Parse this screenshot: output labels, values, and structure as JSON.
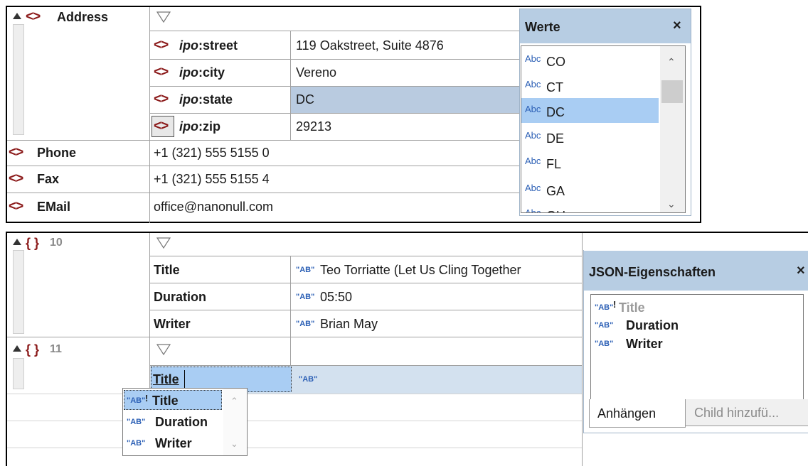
{
  "xml_grid": {
    "address": {
      "icon": "element-icon",
      "label": "Address"
    },
    "rows": [
      {
        "prefix": "ipo",
        "name": "street",
        "value": "119 Oakstreet, Suite 4876"
      },
      {
        "prefix": "ipo",
        "name": "city",
        "value": "Vereno"
      },
      {
        "prefix": "ipo",
        "name": "state",
        "value": "DC"
      },
      {
        "prefix": "ipo",
        "name": "zip",
        "value": "29213"
      }
    ],
    "top_rows": [
      {
        "label": "Phone",
        "value": "+1 (321) 555 5155 0"
      },
      {
        "label": "Fax",
        "value": "+1 (321) 555 5155 4"
      },
      {
        "label": "EMail",
        "value": "office@nanonull.com"
      }
    ]
  },
  "werte_panel": {
    "title": "Werte",
    "close": "×",
    "items": [
      {
        "icon": "Abc",
        "value": "CO"
      },
      {
        "icon": "Abc",
        "value": "CT"
      },
      {
        "icon": "Abc",
        "value": "DC",
        "selected": true
      },
      {
        "icon": "Abc",
        "value": "DE"
      },
      {
        "icon": "Abc",
        "value": "FL"
      },
      {
        "icon": "Abc",
        "value": "GA"
      },
      {
        "icon": "Abc",
        "value": "GU"
      }
    ]
  },
  "json_grid": {
    "obj10": {
      "label": "{ }",
      "index": "10"
    },
    "obj10_rows": [
      {
        "key": "Title",
        "type": "\"AB\"",
        "value": "Teo Torriatte (Let Us Cling Together"
      },
      {
        "key": "Duration",
        "type": "\"AB\"",
        "value": "05:50"
      },
      {
        "key": "Writer",
        "type": "\"AB\"",
        "value": "Brian May"
      }
    ],
    "obj11": {
      "label": "{ }",
      "index": "11"
    },
    "obj11_row": {
      "key": "Title",
      "type": "\"AB\""
    },
    "autocomplete": [
      {
        "type": "\"AB\"",
        "required": "!",
        "label": "Title",
        "selected": true
      },
      {
        "type": "\"AB\"",
        "label": "Duration"
      },
      {
        "type": "\"AB\"",
        "label": "Writer"
      }
    ]
  },
  "json_panel": {
    "title": "JSON-Eigenschaften",
    "close": "×",
    "items": [
      {
        "type": "\"AB\"",
        "required": "!",
        "label": "Title",
        "used": true
      },
      {
        "type": "\"AB\"",
        "label": "Duration"
      },
      {
        "type": "\"AB\"",
        "label": "Writer"
      }
    ],
    "tabs": [
      "Anhängen",
      "Child hinzufü..."
    ]
  }
}
